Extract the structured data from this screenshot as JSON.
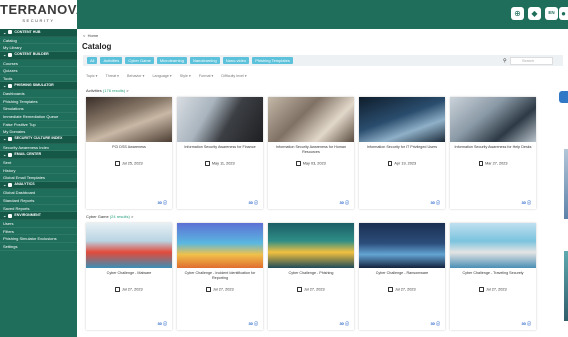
{
  "brand": {
    "name": "TERRANOVA",
    "sub": "SECURITY"
  },
  "sidebar": [
    {
      "type": "section",
      "label": "CONTENT HUB"
    },
    {
      "type": "item",
      "label": "Catalog"
    },
    {
      "type": "item",
      "label": "My Library"
    },
    {
      "type": "section",
      "label": "CONTENT BUILDER"
    },
    {
      "type": "item",
      "label": "Courses"
    },
    {
      "type": "item",
      "label": "Quizzes"
    },
    {
      "type": "item",
      "label": "Tools"
    },
    {
      "type": "section",
      "label": "PHISHING SIMULATOR"
    },
    {
      "type": "item",
      "label": "Dashboards"
    },
    {
      "type": "item",
      "label": "Phishing Templates"
    },
    {
      "type": "item",
      "label": "Simulations"
    },
    {
      "type": "item",
      "label": "Immediate Remediation Queue"
    },
    {
      "type": "item",
      "label": "False Positive Tup"
    },
    {
      "type": "item",
      "label": "My Domains"
    },
    {
      "type": "section",
      "label": "SECURITY CULTURE INDEX"
    },
    {
      "type": "item",
      "label": "Security Awareness Index"
    },
    {
      "type": "section",
      "label": "EMAIL CENTER"
    },
    {
      "type": "item",
      "label": "Sent"
    },
    {
      "type": "item",
      "label": "History"
    },
    {
      "type": "item",
      "label": "Global Email Templates"
    },
    {
      "type": "section",
      "label": "ANALYTICS"
    },
    {
      "type": "item",
      "label": "Global Dashboard"
    },
    {
      "type": "item",
      "label": "Standard Reports"
    },
    {
      "type": "item",
      "label": "Saved Reports"
    },
    {
      "type": "section",
      "label": "ENVIRONMENT"
    },
    {
      "type": "item",
      "label": "Users"
    },
    {
      "type": "item",
      "label": "Filters"
    },
    {
      "type": "item",
      "label": "Phishing Simulator Exclusions"
    },
    {
      "type": "item",
      "label": "Settings"
    }
  ],
  "topbar": {
    "lang": "EN",
    "lang_sub": "ENGL"
  },
  "breadcrumb": "Home",
  "page_title": "Catalog",
  "tabs": [
    "All",
    "Activities",
    "Cyber Game",
    "Microlearning",
    "Nanolearning",
    "Nano-video",
    "Phishing Templates"
  ],
  "search_placeholder": "Search",
  "filters": [
    "Topic ▾",
    "Threat ▾",
    "Behavior ▾",
    "Language ▾",
    "Style ▾",
    "Format ▾",
    "Difficulty level ▾"
  ],
  "activities": {
    "label": "Activities",
    "count": "(176 results)",
    "arrow": ">",
    "cards": [
      {
        "title": "PCI DSS Awareness",
        "date": "Jul 25, 2023",
        "foot": "30 ⓢ"
      },
      {
        "title": "Information Security Awareness for Finance",
        "date": "May 11, 2023",
        "foot": "30 ⓢ"
      },
      {
        "title": "Information Security Awareness for Human Resources",
        "date": "May 03, 2023",
        "foot": "30 ⓢ"
      },
      {
        "title": "Information Security for IT Privileged Users",
        "date": "Apr 19, 2023",
        "foot": "30 ⓢ"
      },
      {
        "title": "Information Security Awareness for Help Desks",
        "date": "Mar 27, 2023",
        "foot": "30 ⓢ"
      }
    ]
  },
  "cybergame": {
    "label": "Cyber Game",
    "count": "(24 results)",
    "arrow": ">",
    "cards": [
      {
        "title": "Cyber Challenge - Malware",
        "date": "Jul 27, 2023",
        "foot": "30 ⓢ"
      },
      {
        "title": "Cyber Challenge - Incident Identification for Reporting",
        "date": "Jul 27, 2023",
        "foot": "30 ⓢ"
      },
      {
        "title": "Cyber Challenge - Phishing",
        "date": "Jul 27, 2023",
        "foot": "30 ⓢ"
      },
      {
        "title": "Cyber Challenge - Ransomware",
        "date": "Jul 27, 2023",
        "foot": "30 ⓢ"
      },
      {
        "title": "Cyber Challenge - Traveling Securely",
        "date": "Jul 27, 2023",
        "foot": "30 ⓢ"
      }
    ]
  },
  "colors": {
    "brand_green": "#1f6e5b",
    "tab_blue": "#5cc1da",
    "link_green": "#2aa07e",
    "accent_blue": "#2a66c8"
  }
}
